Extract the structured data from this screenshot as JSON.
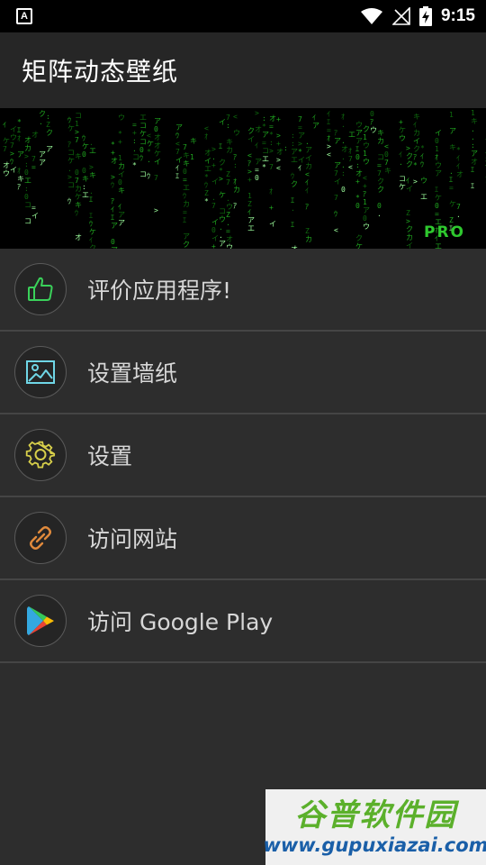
{
  "status_bar": {
    "notification_icon": "A",
    "time": "9:15",
    "icons": [
      "wifi-icon",
      "no-signal-icon",
      "battery-charging-icon"
    ]
  },
  "app_bar": {
    "title": "矩阵动态壁纸"
  },
  "banner": {
    "badge": "PRO",
    "accent_color": "#1fd01f"
  },
  "menu": {
    "items": [
      {
        "label": "评价应用程序!",
        "icon": "thumbs-up-icon",
        "icon_color": "#3ad15a"
      },
      {
        "label": "设置墙纸",
        "icon": "image-icon",
        "icon_color": "#6fd6e6"
      },
      {
        "label": "设置",
        "icon": "gear-icon",
        "icon_color": "#d7cf4a"
      },
      {
        "label": "访问网站",
        "icon": "link-icon",
        "icon_color": "#e08a3c"
      },
      {
        "label": "访问 Google Play",
        "icon": "google-play-icon",
        "icon_color": "#34a853"
      }
    ]
  },
  "watermark": {
    "brand": "谷普软件园",
    "url": "www.gupuxiazai.com"
  }
}
